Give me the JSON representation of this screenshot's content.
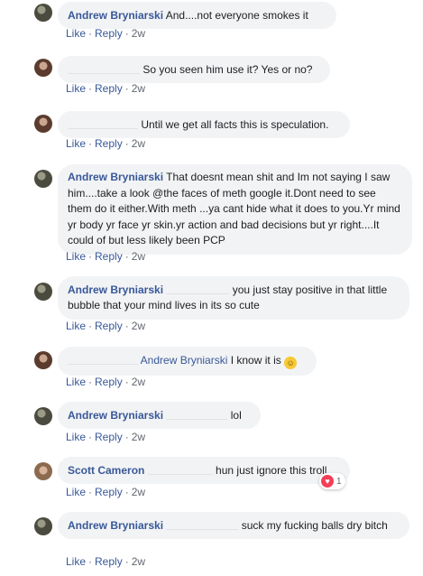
{
  "actions": {
    "like": "Like",
    "reply": "Reply",
    "sep": "·"
  },
  "comments": [
    {
      "name": "Andrew Bryniarski",
      "text": "And....not everyone smokes it",
      "time": "2w",
      "avatar": "person-photo"
    },
    {
      "name": "",
      "text": "So you seen him use it? Yes or no?",
      "time": "2w",
      "avatar": "person-photo"
    },
    {
      "name": "",
      "text": "Until we get all facts this is speculation.",
      "time": "2w",
      "avatar": "person-photo"
    },
    {
      "name": "Andrew Bryniarski",
      "text": "That doesnt mean shit and Im not saying I saw him....take a look @the faces of meth google it.Dont need to see them do it either.With meth ...ya cant hide what it does to you.Yr mind yr body yr face yr skin.yr action and bad decisions but yr right....It could of but less likely been PCP",
      "time": "2w",
      "avatar": "person-photo"
    },
    {
      "name": "Andrew Bryniarski",
      "text": "you just stay positive in that little bubble that your mind lives in its so cute",
      "time": "2w",
      "avatar": "person-photo"
    },
    {
      "name": "",
      "mention": "Andrew Bryniarski",
      "text": "I know it is",
      "emoji": "smile-emoji",
      "time": "2w",
      "avatar": "person-photo"
    },
    {
      "name": "Andrew Bryniarski",
      "text": "lol",
      "time": "2w",
      "avatar": "person-photo"
    },
    {
      "name": "Scott Cameron",
      "text": "hun just ignore this troll",
      "time": "2w",
      "avatar": "person-photo",
      "reactions": {
        "icon": "heart-icon",
        "count": "1"
      }
    },
    {
      "name": "Andrew Bryniarski",
      "text": "suck my fucking balls dry bitch",
      "time": "2w",
      "avatar": "person-photo"
    }
  ]
}
